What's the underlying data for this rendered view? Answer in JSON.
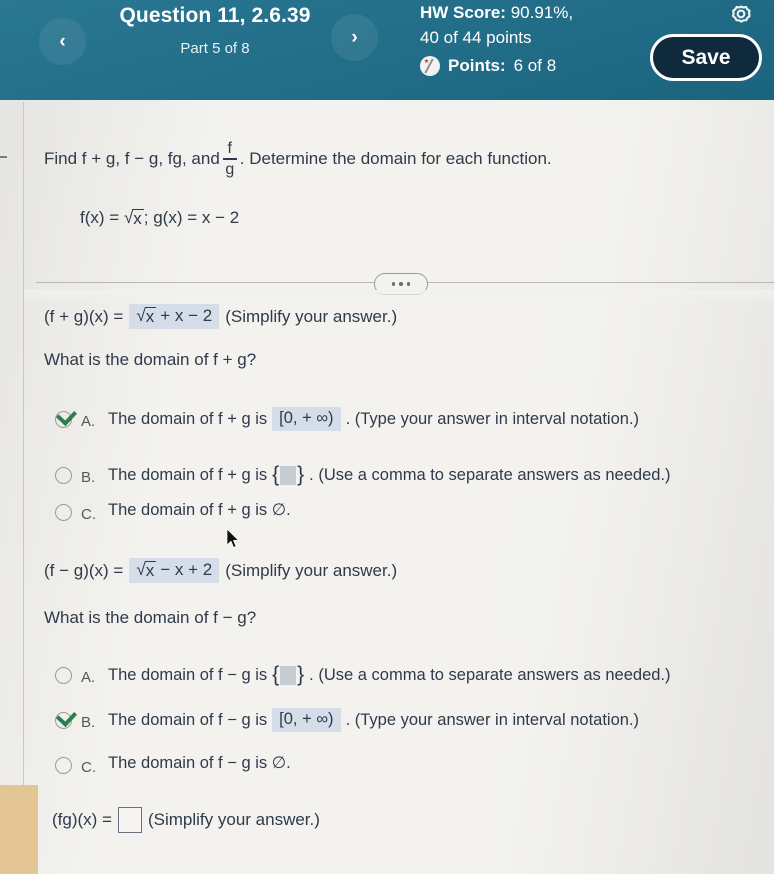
{
  "header": {
    "prev_icon": "chevron-left-icon",
    "next_icon": "chevron-right-icon",
    "prev_label": "‹",
    "next_label": "›",
    "question_title": "Question 11, 2.6.39",
    "part_label": "Part 5 of 8",
    "hw_score_label": "HW Score:",
    "hw_score_value": "90.91%,",
    "points_earned_line": "40 of 44 points",
    "points_label": "Points:",
    "points_value": "6 of 8",
    "save_label": "Save",
    "gear_icon": "gear-icon",
    "partial_credit_icon": "partial-credit-badge-icon",
    "bg_color": "#1d6f8c",
    "save_bg_color": "#0e2a3c"
  },
  "problem": {
    "prompt_part1": "Find f + g, f − g, fg, and",
    "fraction_numerator": "f",
    "fraction_denominator": "g",
    "prompt_part2": ". Determine the domain for each function.",
    "functions_lead": "f(x) =",
    "functions_radical": "√",
    "functions_radicand": "x",
    "functions_mid": "; g(x) = x − 2"
  },
  "divider": {
    "ellipsis_icon": "ellipsis-menu-icon",
    "dots": [
      "dot",
      "dot",
      "dot"
    ]
  },
  "sum_section": {
    "expression_label": "(f + g)(x) =",
    "answer_radical": "√",
    "answer_radicand": "x",
    "answer_rest": "+ x − 2",
    "hint": "(Simplify your answer.)",
    "question": "What is the domain of f + g?",
    "options": [
      {
        "letter": "A.",
        "text_before": "The domain of f + g is",
        "boxed_value": "[0, + ∞)",
        "text_after": ". (Type your answer in interval notation.)",
        "selected": true,
        "kind": "interval"
      },
      {
        "letter": "B.",
        "text_before": "The domain of f + g is",
        "text_after": ". (Use a comma to separate answers as needed.)",
        "selected": false,
        "kind": "set"
      },
      {
        "letter": "C.",
        "text_before": "The domain of f + g is ∅.",
        "selected": false,
        "kind": "plain"
      }
    ]
  },
  "diff_section": {
    "expression_label": "(f − g)(x) =",
    "answer_radical": "√",
    "answer_radicand": "x",
    "answer_rest": "− x + 2",
    "hint": "(Simplify your answer.)",
    "question": "What is the domain of f − g?",
    "options": [
      {
        "letter": "A.",
        "text_before": "The domain of f − g is",
        "text_after": ". (Use a comma to separate answers as needed.)",
        "selected": false,
        "kind": "set"
      },
      {
        "letter": "B.",
        "text_before": "The domain of f − g is",
        "boxed_value": "[0, + ∞)",
        "text_after": ". (Type your answer in interval notation.)",
        "selected": true,
        "kind": "interval"
      },
      {
        "letter": "C.",
        "text_before": "The domain of f − g is ∅.",
        "selected": false,
        "kind": "plain"
      }
    ]
  },
  "product_section": {
    "expression_label": "(fg)(x) =",
    "input_value": "",
    "hint": "(Simplify your answer.)"
  },
  "colors": {
    "header_blue": "#1d6f8c",
    "page_bg": "#f2f1ed",
    "answer_highlight": "#d5dde9",
    "check_green": "#2e7d4f",
    "corner_tab": "#e3c693"
  }
}
